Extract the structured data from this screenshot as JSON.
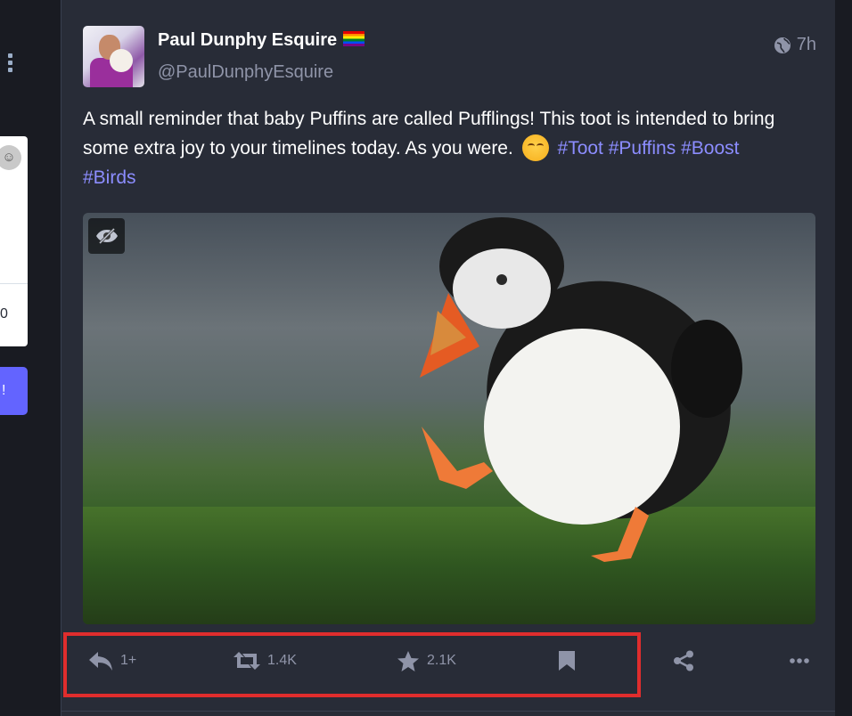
{
  "post": {
    "display_name": "Paul Dunphy Esquire",
    "handle": "@PaulDunphyEsquire",
    "timestamp": "7h",
    "content_text": "A small reminder that baby Puffins are called Pufflings! This toot is intended to bring some extra joy to your timelines today. As you were.",
    "hashtags": [
      "#Toot",
      "#Puffins",
      "#Boost",
      "#Birds"
    ],
    "media_hidden_icon": "eye-slash-icon"
  },
  "actions": {
    "reply_count": "1+",
    "boost_count": "1.4K",
    "favourite_count": "2.1K"
  },
  "sidebar": {
    "button_label": "!",
    "card_digit": "0"
  },
  "colors": {
    "background": "#191b22",
    "post_background": "#282c37",
    "hashtag": "#8c8dff",
    "muted": "#8f94a8",
    "highlight": "#e02d2d",
    "accent": "#6364ff"
  }
}
